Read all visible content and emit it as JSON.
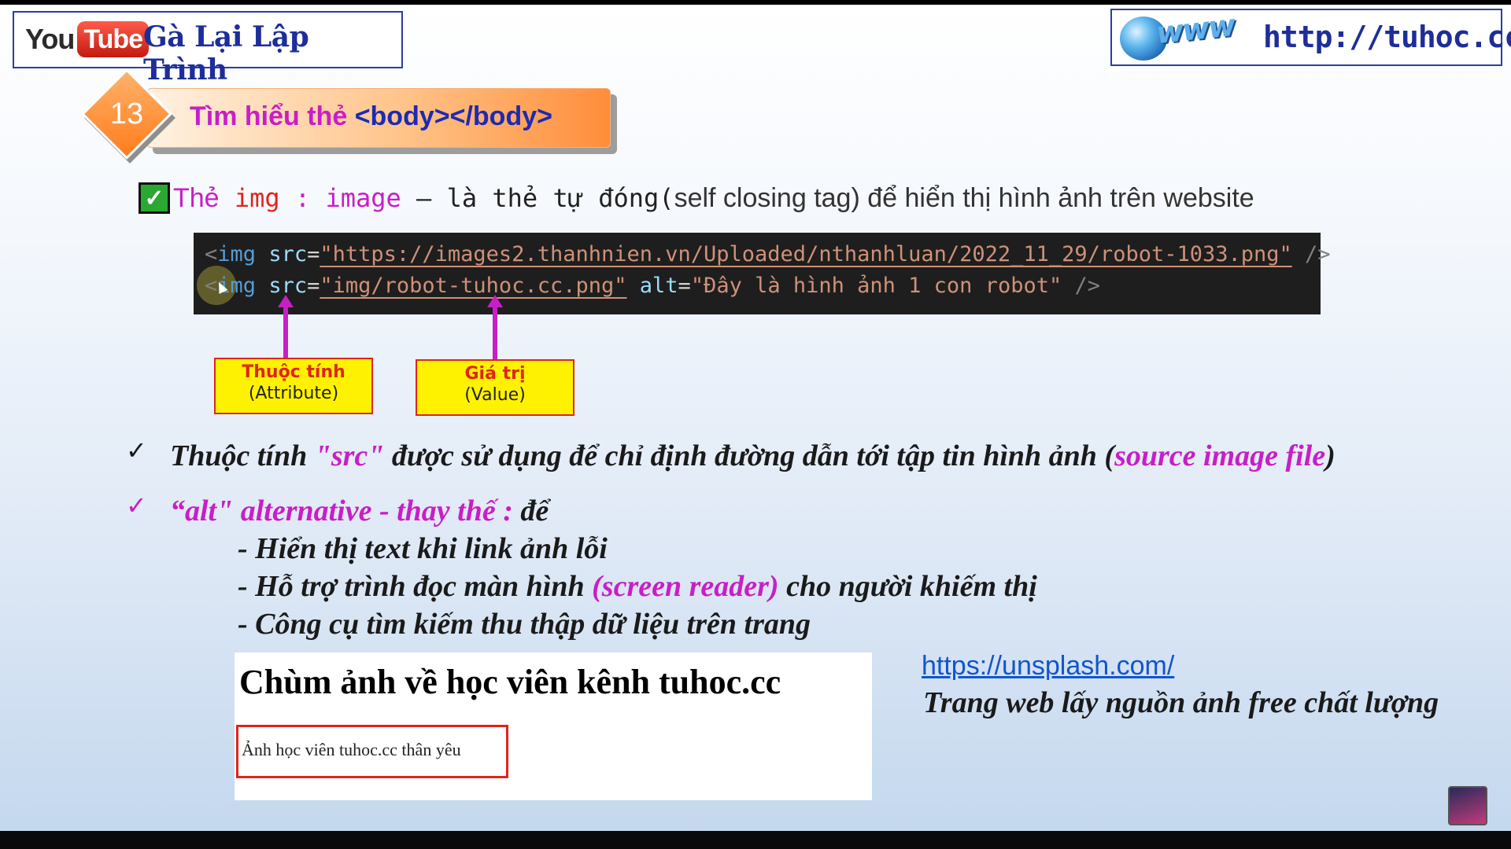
{
  "header": {
    "logo_you": "You",
    "logo_tube": "Tube",
    "channel_name": "Gà Lại Lập Trình",
    "www_mark": "www",
    "site_url": "http://tuhoc.cc"
  },
  "lesson": {
    "number": "13",
    "title_prefix": "Tìm hiểu thẻ ",
    "title_tag": "<body></body>"
  },
  "statement": {
    "the": "Thẻ",
    "img": "img",
    "sep": ":",
    "image": "image",
    "dash_desc": " – là thẻ tự đóng(",
    "rest": "self closing tag) để hiển thị hình ảnh trên website"
  },
  "code": {
    "line1": {
      "open": "<",
      "tag": "img",
      "attr": "src",
      "eq": "=",
      "value": "\"https://images2.thanhnien.vn/Uploaded/nthanhluan/2022_11_29/robot-1033.png\"",
      "close": " />"
    },
    "line2": {
      "open": "<",
      "tag": "img",
      "attr": "src",
      "eq": "=",
      "value": "\"img/robot-tuhoc.cc.png\"",
      "attr2": "alt",
      "eq2": "=",
      "value2": "\"Đây là hình ảnh 1 con robot\"",
      "close": " />"
    }
  },
  "labels": {
    "attribute_top": "Thuộc tính",
    "attribute_bottom": "(Attribute)",
    "value_top": "Giá trị",
    "value_bottom": "(Value)"
  },
  "bullets": {
    "tick": "✓",
    "src_a": "Thuộc tính ",
    "src_b": "\"src\"",
    "src_c": " được sử dụng để chỉ định đường dẫn tới tập tin hình ảnh (",
    "src_d": "source image file",
    "src_e": ")",
    "alt_a": "“alt\"  alternative - thay thế : ",
    "alt_b": "để",
    "sub1": "- Hiển thị text khi link ảnh lỗi",
    "sub2_a": "- Hỗ trợ trình đọc màn hình ",
    "sub2_b": "(screen reader)",
    "sub2_c": " cho người khiếm thị",
    "sub3": "- Công cụ tìm kiếm thu thập dữ liệu trên trang"
  },
  "preview": {
    "title": "Chùm ảnh về học viên kênh tuhoc.cc",
    "alt_text": "Ảnh học viên tuhoc.cc thân yêu"
  },
  "resource": {
    "link": "https://unsplash.com/",
    "desc": "Trang web lấy nguồn ảnh free chất lượng"
  },
  "colors": {
    "magenta": "#c81ec7",
    "navy": "#1d2e9a",
    "red": "#e0241b",
    "yellow": "#fff200",
    "orange": "#ff8d3a"
  }
}
